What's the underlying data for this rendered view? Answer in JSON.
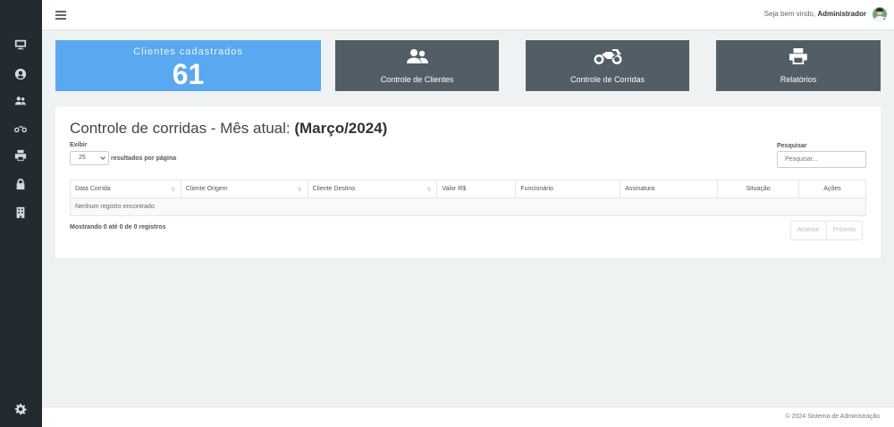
{
  "topbar": {
    "welcome_prefix": "Seja bem vindo,",
    "user_name": "Administrador"
  },
  "sidebar": {
    "items": [
      {
        "icon": "monitor-icon"
      },
      {
        "icon": "user-circle-icon"
      },
      {
        "icon": "users-icon"
      },
      {
        "icon": "motorcycle-icon"
      },
      {
        "icon": "printer-icon"
      },
      {
        "icon": "lock-icon"
      },
      {
        "icon": "building-icon"
      }
    ],
    "footer_icon": "gear-icon"
  },
  "cards": {
    "stat_label": "Clientes cadastrados",
    "stat_value": "61",
    "clients_label": "Controle de Clientes",
    "rides_label": "Controle de Corridas",
    "reports_label": "Relatórios"
  },
  "panel": {
    "title_prefix": "Controle de corridas - Mês atual:",
    "title_month": "(Março/2024)",
    "show_label": "Exibir",
    "page_length": "25",
    "per_page_label": "resultados por página",
    "search_label": "Pesquisar",
    "search_placeholder": "Pesquisar..."
  },
  "table": {
    "columns": [
      "Data Corrida",
      "Cliente Origem",
      "Cliente Destino",
      "Valor R$",
      "Funcionário",
      "Assinatura",
      "Situação",
      "Ações"
    ],
    "empty_text": "Nenhum registro encontrado",
    "info": "Mostrando 0 até 0 de 0 registros",
    "prev_label": "Anterior",
    "next_label": "Próximo"
  },
  "footer": {
    "copyright": "© 2024 Sistema de Administração"
  },
  "colors": {
    "sidebar_bg": "#222b30",
    "stat_card": "#5aa8ef",
    "action_card": "#525e66"
  }
}
